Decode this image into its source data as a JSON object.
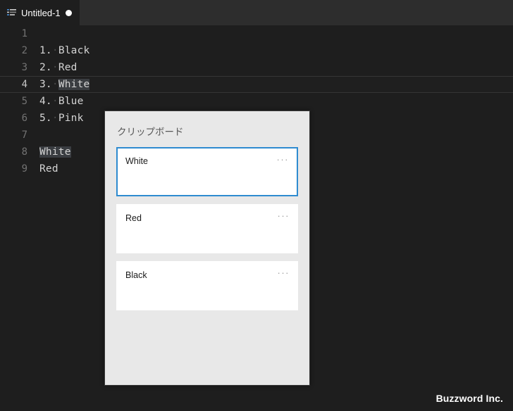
{
  "window": {
    "background_color": "#1e1e1e",
    "tabbar_color": "#2d2d2d"
  },
  "tabbar": {
    "tab": {
      "icon": "list-lines-icon",
      "title": "Untitled-1",
      "dirty_indicator": "●"
    }
  },
  "editor": {
    "lines": [
      {
        "number": "1",
        "active": false,
        "segments": []
      },
      {
        "number": "2",
        "active": false,
        "segments": [
          {
            "text": "1.",
            "style": "plain"
          },
          {
            "text": "·",
            "style": "ws"
          },
          {
            "text": "Black",
            "style": "plain"
          }
        ]
      },
      {
        "number": "3",
        "active": false,
        "segments": [
          {
            "text": "2.",
            "style": "plain"
          },
          {
            "text": "·",
            "style": "ws"
          },
          {
            "text": "Red",
            "style": "plain"
          }
        ]
      },
      {
        "number": "4",
        "active": true,
        "segments": [
          {
            "text": "3.",
            "style": "plain"
          },
          {
            "text": "·",
            "style": "ws"
          },
          {
            "text": "White",
            "style": "sel"
          }
        ]
      },
      {
        "number": "5",
        "active": false,
        "segments": [
          {
            "text": "4.",
            "style": "plain"
          },
          {
            "text": "·",
            "style": "ws"
          },
          {
            "text": "Blue",
            "style": "plain"
          }
        ]
      },
      {
        "number": "6",
        "active": false,
        "segments": [
          {
            "text": "5.",
            "style": "plain"
          },
          {
            "text": "·",
            "style": "ws"
          },
          {
            "text": "Pink",
            "style": "plain"
          }
        ]
      },
      {
        "number": "7",
        "active": false,
        "segments": []
      },
      {
        "number": "8",
        "active": false,
        "segments": [
          {
            "text": "White",
            "style": "sel"
          }
        ]
      },
      {
        "number": "9",
        "active": false,
        "segments": [
          {
            "text": "Red",
            "style": "plain"
          }
        ]
      }
    ]
  },
  "clipboard_panel": {
    "title": "クリップボード",
    "accent_color": "#2e8bd0",
    "background_color": "#e8e8e8",
    "menu_glyph": "···",
    "items": [
      {
        "text": "White",
        "selected": true
      },
      {
        "text": "Red",
        "selected": false
      },
      {
        "text": "Black",
        "selected": false
      }
    ]
  },
  "footer": {
    "watermark": "Buzzword Inc."
  }
}
